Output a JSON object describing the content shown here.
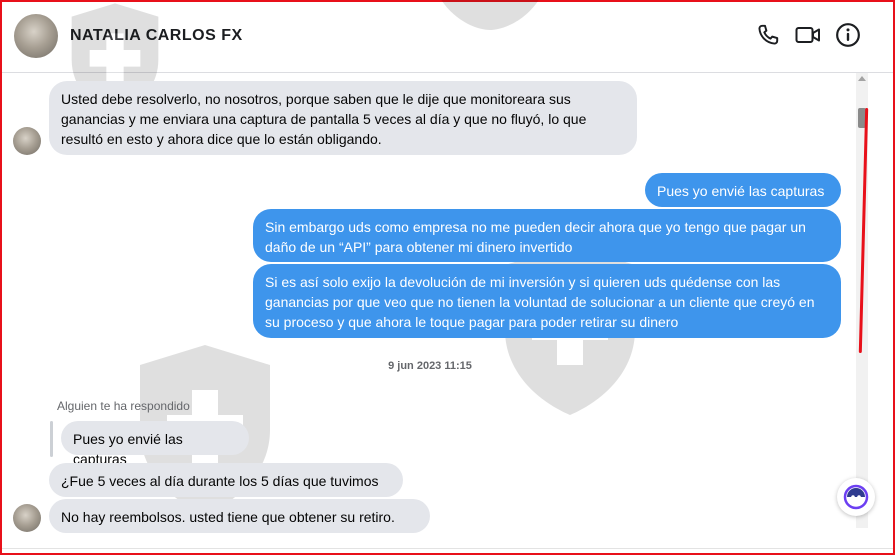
{
  "header": {
    "contact_name": "NATALIA CARLOS FX",
    "icons": [
      "phone-icon",
      "video-camera-icon",
      "info-icon"
    ]
  },
  "messages": [
    {
      "side": "in",
      "text": "Usted debe resolverlo, no nosotros, porque saben que le dije que monitoreara sus ganancias y me enviara una captura de pantalla 5 veces al día y que no fluyó, lo que resultó en esto y ahora dice que lo están obligando."
    },
    {
      "side": "out",
      "text": "Pues yo envié las capturas"
    },
    {
      "side": "out",
      "text": "Sin embargo uds como empresa no me pueden decir ahora que yo tengo que pagar un daño de un “API” para obtener mi dinero invertido"
    },
    {
      "side": "out",
      "text": "Si es así solo exijo la devolución de mi inversión y si quieren uds quédense con las ganancias por que veo que no tienen la voluntad de solucionar a un cliente que creyó en su proceso y que ahora le toque pagar para poder retirar su dinero"
    },
    {
      "side": "in",
      "text": "Pues yo envié las capturas"
    },
    {
      "side": "in",
      "text": "¿Fue 5 veces al día durante los 5 días que tuvimos"
    },
    {
      "side": "in",
      "text": "No hay reembolsos. usted tiene que obtener su retiro."
    }
  ],
  "timestamp": "9 jun 2023 11:15",
  "reply_note": "Alguien te ha respondido",
  "colors": {
    "outgoing_bubble": "#3e95ec",
    "incoming_bubble": "#e4e6eb",
    "annotation_red": "#e8101a"
  }
}
